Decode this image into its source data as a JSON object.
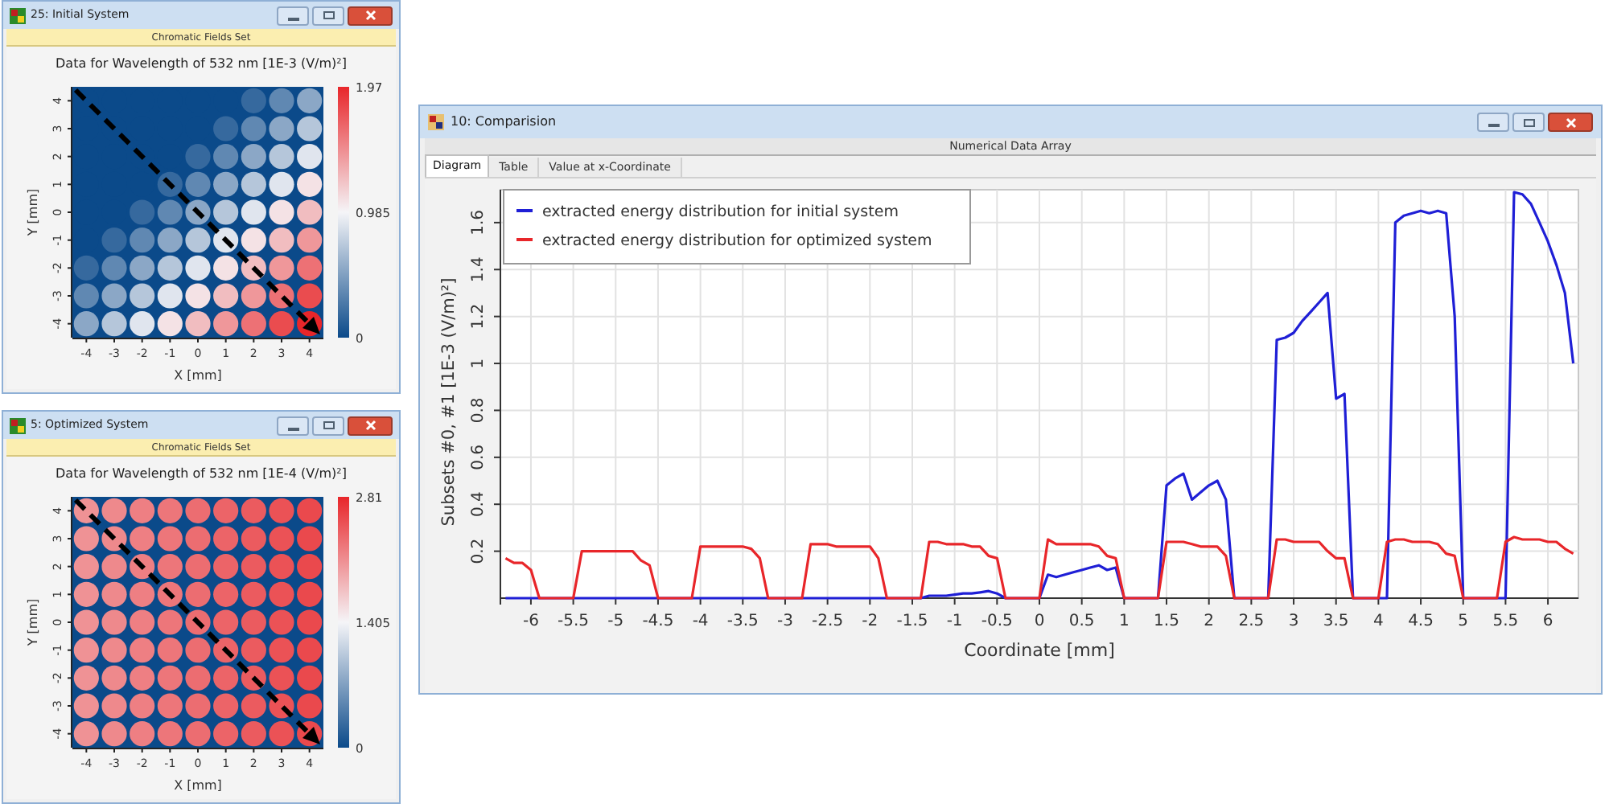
{
  "left_windows": [
    {
      "title": "25: Initial System",
      "ribbon": "Chromatic Fields Set",
      "plot_title": "Data for Wavelength of 532 nm [1E-3 (V/m)²]",
      "kind": "rising",
      "colorbar_labels": [
        "1.97",
        "0.985",
        "0"
      ],
      "xticks": [
        "-4",
        "-3",
        "-2",
        "-1",
        "0",
        "1",
        "2",
        "3",
        "4"
      ],
      "yticks": [
        "4",
        "3",
        "2",
        "1",
        "0",
        "-1",
        "-2",
        "-3",
        "-4"
      ],
      "xlabel": "X [mm]",
      "ylabel": "Y [mm]"
    },
    {
      "title": "5: Optimized System",
      "ribbon": "Chromatic Fields Set",
      "plot_title": "Data for Wavelength of 532 nm [1E-4 (V/m)²]",
      "kind": "uniform",
      "colorbar_labels": [
        "2.81",
        "1.405",
        "0"
      ],
      "xticks": [
        "-4",
        "-3",
        "-2",
        "-1",
        "0",
        "1",
        "2",
        "3",
        "4"
      ],
      "yticks": [
        "4",
        "3",
        "2",
        "1",
        "0",
        "-1",
        "-2",
        "-3",
        "-4"
      ],
      "xlabel": "X [mm]",
      "ylabel": "Y [mm]"
    }
  ],
  "comparison": {
    "title": "10: Comparision",
    "ribbon": "Numerical Data Array",
    "tabs": [
      {
        "label": "Diagram",
        "selected": true
      },
      {
        "label": "Table",
        "selected": false
      },
      {
        "label": "Value at x-Coordinate",
        "selected": false
      }
    ],
    "chart_data": {
      "type": "line",
      "grid": true,
      "legend": true,
      "xlabel": "Coordinate [mm]",
      "ylabel": "Subsets #0, #1 [1E-3 (V/m)²]",
      "xlim": [
        -6.36,
        6.36
      ],
      "ylim": [
        0,
        1.74
      ],
      "xticks": [
        -6,
        -5.5,
        -5,
        -4.5,
        -4,
        -3.5,
        -3,
        -2.5,
        -2,
        -1.5,
        -1,
        -0.5,
        0,
        0.5,
        1,
        1.5,
        2,
        2.5,
        3,
        3.5,
        4,
        4.5,
        5,
        5.5,
        6
      ],
      "yticks": [
        0.2,
        0.4,
        0.6,
        0.8,
        1,
        1.2,
        1.4,
        1.6
      ],
      "x": [
        -6.3,
        -6.2,
        -6.1,
        -6.0,
        -5.9,
        -5.8,
        -5.7,
        -5.6,
        -5.5,
        -5.4,
        -5.3,
        -5.2,
        -5.1,
        -5.0,
        -4.9,
        -4.8,
        -4.7,
        -4.6,
        -4.5,
        -4.4,
        -4.3,
        -4.2,
        -4.1,
        -4.0,
        -3.9,
        -3.8,
        -3.7,
        -3.6,
        -3.5,
        -3.4,
        -3.3,
        -3.2,
        -3.1,
        -3.0,
        -2.9,
        -2.8,
        -2.7,
        -2.6,
        -2.5,
        -2.4,
        -2.3,
        -2.2,
        -2.1,
        -2.0,
        -1.9,
        -1.8,
        -1.7,
        -1.6,
        -1.5,
        -1.4,
        -1.3,
        -1.2,
        -1.1,
        -1.0,
        -0.9,
        -0.8,
        -0.7,
        -0.6,
        -0.5,
        -0.4,
        -0.3,
        -0.2,
        -0.1,
        0.0,
        0.1,
        0.2,
        0.3,
        0.4,
        0.5,
        0.6,
        0.7,
        0.8,
        0.9,
        1.0,
        1.1,
        1.2,
        1.3,
        1.4,
        1.5,
        1.6,
        1.7,
        1.8,
        1.9,
        2.0,
        2.1,
        2.2,
        2.3,
        2.4,
        2.5,
        2.6,
        2.7,
        2.8,
        2.9,
        3.0,
        3.1,
        3.2,
        3.3,
        3.4,
        3.5,
        3.6,
        3.7,
        3.8,
        3.9,
        4.0,
        4.1,
        4.2,
        4.3,
        4.4,
        4.5,
        4.6,
        4.7,
        4.8,
        4.9,
        5.0,
        5.1,
        5.2,
        5.3,
        5.4,
        5.5,
        5.6,
        5.7,
        5.8,
        5.9,
        6.0,
        6.1,
        6.2,
        6.3
      ],
      "series": [
        {
          "name": "extracted energy distribution for initial system",
          "color": "#1f1fd6",
          "values": [
            0,
            0,
            0,
            0,
            0,
            0,
            0,
            0,
            0,
            0,
            0,
            0,
            0,
            0,
            0,
            0,
            0,
            0,
            0,
            0,
            0,
            0,
            0,
            0,
            0,
            0,
            0,
            0,
            0,
            0,
            0,
            0,
            0,
            0,
            0,
            0,
            0,
            0,
            0,
            0,
            0,
            0,
            0,
            0,
            0,
            0,
            0,
            0,
            0,
            0,
            0.01,
            0.01,
            0.01,
            0.015,
            0.02,
            0.02,
            0.025,
            0.03,
            0.02,
            0,
            0,
            0,
            0,
            0,
            0.1,
            0.09,
            0.1,
            0.11,
            0.12,
            0.13,
            0.14,
            0.12,
            0.13,
            0,
            0,
            0,
            0,
            0,
            0.48,
            0.51,
            0.53,
            0.42,
            0.45,
            0.48,
            0.5,
            0.42,
            0,
            0,
            0,
            0,
            0,
            1.1,
            1.11,
            1.13,
            1.18,
            1.22,
            1.26,
            1.3,
            0.85,
            0.87,
            0,
            0,
            0,
            0,
            0,
            1.6,
            1.63,
            1.64,
            1.65,
            1.64,
            1.65,
            1.64,
            1.2,
            0,
            0,
            0,
            0,
            0,
            0,
            1.73,
            1.72,
            1.68,
            1.6,
            1.52,
            1.42,
            1.3,
            1.0
          ]
        },
        {
          "name": "extracted energy distribution for optimized system",
          "color": "#e8262a",
          "values": [
            0.17,
            0.15,
            0.15,
            0.12,
            0,
            0,
            0,
            0,
            0,
            0.2,
            0.2,
            0.2,
            0.2,
            0.2,
            0.2,
            0.2,
            0.16,
            0.14,
            0,
            0,
            0,
            0,
            0,
            0.22,
            0.22,
            0.22,
            0.22,
            0.22,
            0.22,
            0.21,
            0.17,
            0,
            0,
            0,
            0,
            0,
            0.23,
            0.23,
            0.23,
            0.22,
            0.22,
            0.22,
            0.22,
            0.22,
            0.17,
            0,
            0,
            0,
            0,
            0,
            0.24,
            0.24,
            0.23,
            0.23,
            0.23,
            0.22,
            0.22,
            0.18,
            0.17,
            0,
            0,
            0,
            0,
            0,
            0.25,
            0.23,
            0.23,
            0.23,
            0.23,
            0.23,
            0.22,
            0.18,
            0.17,
            0,
            0,
            0,
            0,
            0,
            0.24,
            0.24,
            0.24,
            0.23,
            0.22,
            0.22,
            0.22,
            0.18,
            0,
            0,
            0,
            0,
            0,
            0.25,
            0.25,
            0.24,
            0.24,
            0.24,
            0.24,
            0.2,
            0.17,
            0.17,
            0,
            0,
            0,
            0,
            0.24,
            0.25,
            0.25,
            0.24,
            0.24,
            0.24,
            0.23,
            0.19,
            0.18,
            0,
            0,
            0,
            0,
            0,
            0.24,
            0.26,
            0.25,
            0.25,
            0.25,
            0.24,
            0.24,
            0.21,
            0.19
          ]
        }
      ]
    }
  }
}
